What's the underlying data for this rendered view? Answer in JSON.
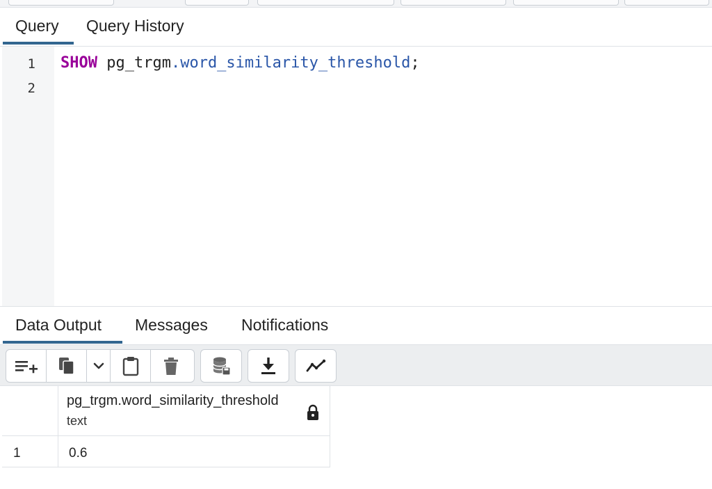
{
  "query_tabs": [
    "Query",
    "Query History"
  ],
  "editor": {
    "line_numbers": [
      "1",
      "2"
    ],
    "line1": {
      "keyword": "SHOW",
      "schema": "pg_trgm",
      "dot": ".",
      "setting": "word_similarity_threshold",
      "terminator": ";"
    }
  },
  "output_tabs": [
    "Data Output",
    "Messages",
    "Notifications"
  ],
  "toolbar_icons": [
    "add-row-icon",
    "copy-icon",
    "copy-options-chevron-icon",
    "paste-icon",
    "delete-icon",
    "save-data-icon",
    "download-icon",
    "graph-icon"
  ],
  "result": {
    "column": {
      "name": "pg_trgm.word_similarity_threshold",
      "type": "text"
    },
    "rows": [
      {
        "row_number": "1",
        "value": "0.6"
      }
    ]
  },
  "colors": {
    "accent": "#326690",
    "keyword": "#990099",
    "property": "#2a56a8"
  }
}
